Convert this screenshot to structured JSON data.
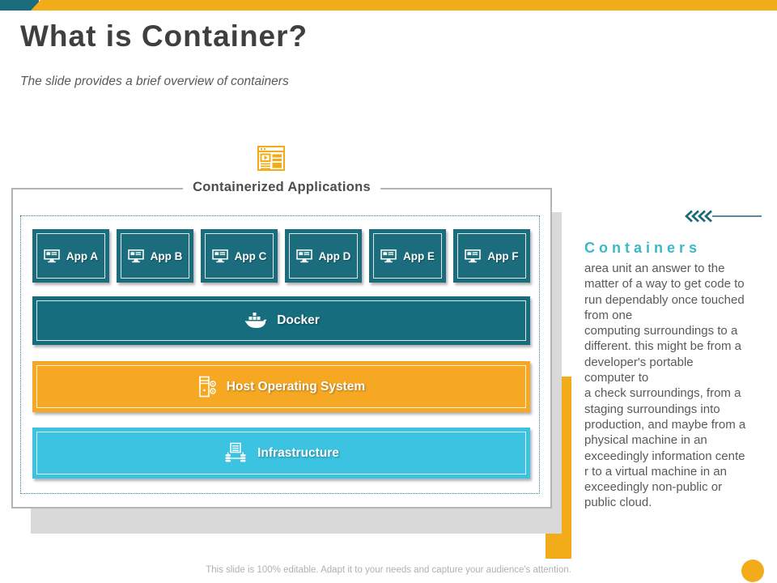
{
  "slide": {
    "title": "What is Container?",
    "subtitle": "The slide provides a brief overview of containers",
    "footer": "This slide is 100% editable. Adapt it to your needs and capture your audience's attention."
  },
  "diagram": {
    "legend": "Containerized Applications",
    "apps": [
      {
        "label": "App A"
      },
      {
        "label": "App B"
      },
      {
        "label": "App C"
      },
      {
        "label": "App D"
      },
      {
        "label": "App E"
      },
      {
        "label": "App F"
      }
    ],
    "layers": {
      "docker": {
        "label": "Docker"
      },
      "host_os": {
        "label": "Host Operating System"
      },
      "infrastructure": {
        "label": "Infrastructure"
      }
    }
  },
  "sidebar": {
    "heading": "Containers",
    "body": "area unit an answer to the\nmatter of a way to get code to\nrun dependably once touched\nfrom one\ncomputing surroundings to a\ndifferent. this might be from a\ndeveloper's portable\ncomputer to\na check surroundings, from a\nstaging surroundings into\nproduction, and maybe from a\nphysical machine in an\nexceedingly information cente\nr to a virtual machine in an\nexceedingly non-public or\npublic cloud."
  },
  "icons": {
    "header": "browser-play-icon",
    "app": "monitor-icon",
    "docker": "docker-whale-icon",
    "host_os": "server-gears-icon",
    "infrastructure": "server-stack-icon",
    "sidebar": "chevrons-left-icon"
  },
  "colors": {
    "teal": "#1B6C7C",
    "docker_teal": "#156D7D",
    "orange": "#F7A823",
    "cyan": "#3BC3E1",
    "accent_yellow": "#F2AC19",
    "heading_turquoise": "#3BB8C6"
  }
}
